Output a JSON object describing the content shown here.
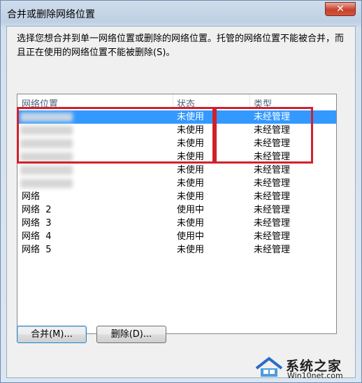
{
  "window": {
    "title": "合并或删除网络位置",
    "close_label": "✕"
  },
  "description": "选择您想合并到单一网络位置或删除的网络位置。托管的网络位置不能被合并，而且正在使用的网络位置不能被删除(S)。",
  "columns": [
    "网络位置",
    "状态",
    "类型"
  ],
  "rows": [
    {
      "name": "",
      "status": "未使用",
      "type": "未经管理",
      "selected": true
    },
    {
      "name": "",
      "status": "未使用",
      "type": "未经管理"
    },
    {
      "name": "",
      "status": "未使用",
      "type": "未经管理"
    },
    {
      "name": "",
      "status": "未使用",
      "type": "未经管理"
    },
    {
      "name": "",
      "status": "未使用",
      "type": "未经管理"
    },
    {
      "name": "",
      "status": "未使用",
      "type": "未经管理"
    },
    {
      "name": "网络",
      "status": "未使用",
      "type": "未经管理"
    },
    {
      "name": "网络  2",
      "status": "使用中",
      "type": "未经管理"
    },
    {
      "name": "网络  3",
      "status": "未使用",
      "type": "未经管理"
    },
    {
      "name": "网络  4",
      "status": "使用中",
      "type": "未经管理"
    },
    {
      "name": "网络  5",
      "status": "未使用",
      "type": "未经管理"
    }
  ],
  "buttons": {
    "merge": "合并(M)...",
    "delete": "删除(D)..."
  },
  "watermark": {
    "brand": "系统之家",
    "url": "Win10net.com"
  },
  "colors": {
    "selection": "#3399ff",
    "highlight_box": "#d0212b"
  }
}
